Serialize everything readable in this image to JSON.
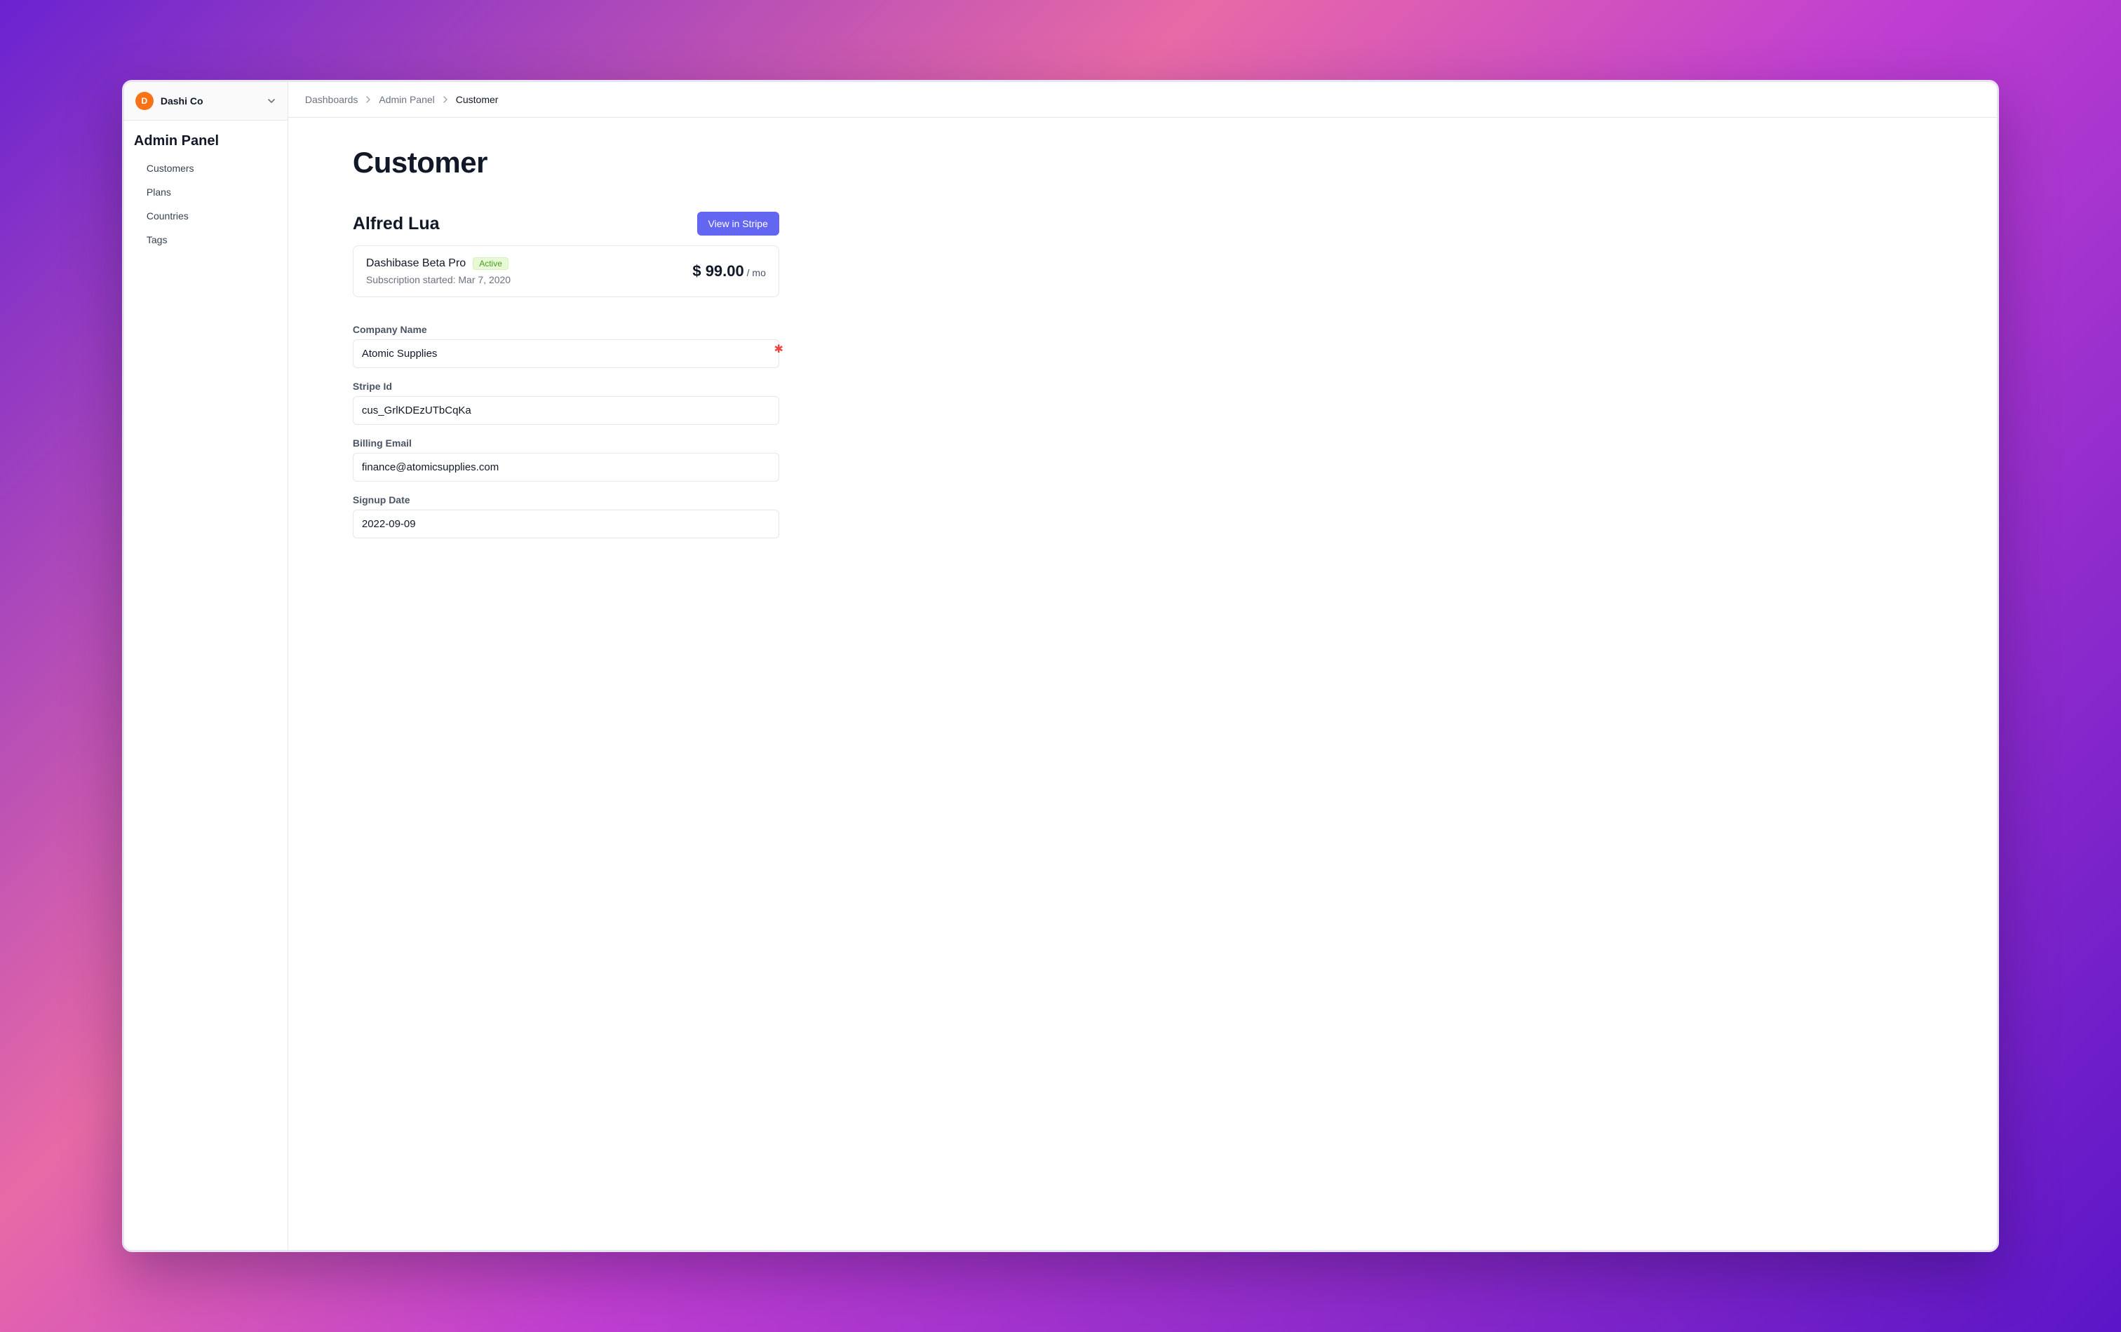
{
  "workspace": {
    "initial": "D",
    "name": "Dashi Co"
  },
  "sidebar": {
    "title": "Admin Panel",
    "items": [
      {
        "label": "Customers"
      },
      {
        "label": "Plans"
      },
      {
        "label": "Countries"
      },
      {
        "label": "Tags"
      }
    ]
  },
  "breadcrumbs": [
    {
      "label": "Dashboards"
    },
    {
      "label": "Admin Panel"
    },
    {
      "label": "Customer"
    }
  ],
  "page": {
    "title": "Customer",
    "customer_name": "Alfred Lua",
    "view_stripe_label": "View in Stripe"
  },
  "subscription": {
    "plan_name": "Dashibase Beta Pro",
    "status_label": "Active",
    "started_label": "Subscription started: Mar 7, 2020",
    "price_main": "$ 99.00",
    "price_suffix": " / mo"
  },
  "fields": {
    "company": {
      "label": "Company Name",
      "value": "Atomic Supplies",
      "required_marker": "✱"
    },
    "stripe_id": {
      "label": "Stripe Id",
      "value": "cus_GrlKDEzUTbCqKa"
    },
    "billing_email": {
      "label": "Billing Email",
      "value": "finance@atomicsupplies.com"
    },
    "signup_date": {
      "label": "Signup Date",
      "value": "2022-09-09"
    }
  },
  "colors": {
    "accent": "#6366f1",
    "avatar_bg": "#f97316",
    "badge_bg": "#e7f9d5",
    "badge_fg": "#4d9a22"
  }
}
